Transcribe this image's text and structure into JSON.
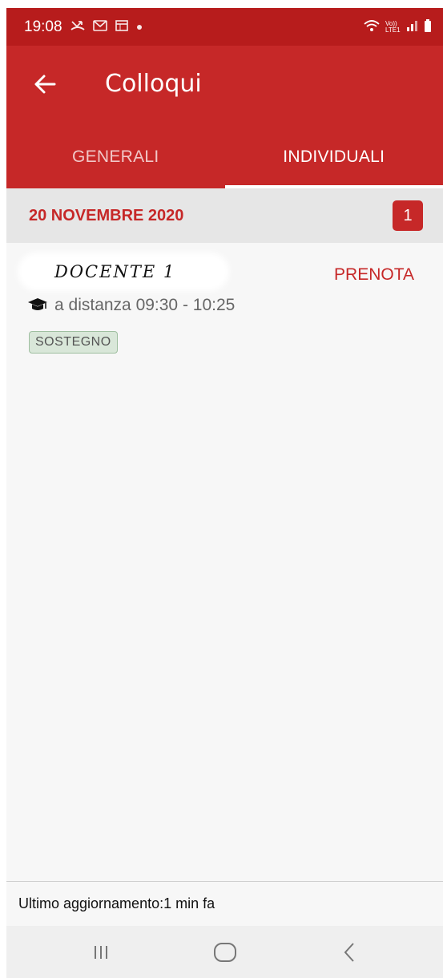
{
  "status_bar": {
    "time": "19:08",
    "icons": [
      "missed-call-icon",
      "gmail-icon",
      "calendar-icon",
      "dot-icon"
    ],
    "right_icons": [
      "wifi-icon",
      "volte-icon",
      "signal-icon",
      "battery-icon"
    ],
    "volte_label": "Vo)) LTE1"
  },
  "app_bar": {
    "title": "Colloqui",
    "back_icon": "arrow-left-icon",
    "color": "#c62828"
  },
  "tabs": [
    {
      "label": "GENERALI",
      "active": false
    },
    {
      "label": "INDIVIDUALI",
      "active": true
    }
  ],
  "date_group": {
    "date": "20 NOVEMBRE 2020",
    "count": "1"
  },
  "entry": {
    "teacher": "DOCENTE 1",
    "action": "PRENOTA",
    "mode_icon": "graduation-cap-icon",
    "details": "a distanza 09:30 - 10:25",
    "tag": "SOSTEGNO"
  },
  "footer": {
    "last_update": "Ultimo aggiornamento:1 min fa"
  },
  "nav_bar": {
    "buttons": [
      "recents-icon",
      "home-icon",
      "back-icon"
    ]
  }
}
